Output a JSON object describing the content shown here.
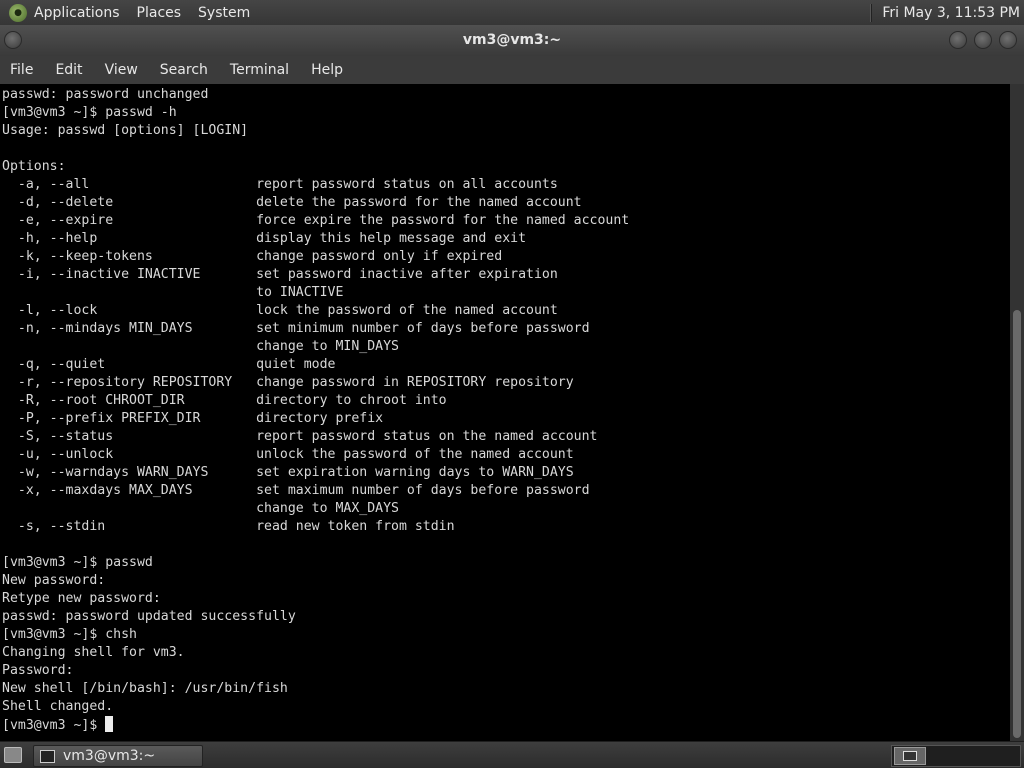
{
  "top_panel": {
    "menus": [
      "Applications",
      "Places",
      "System"
    ],
    "clock": "Fri May  3, 11:53 PM"
  },
  "window": {
    "title": "vm3@vm3:~",
    "menus": [
      "File",
      "Edit",
      "View",
      "Search",
      "Terminal",
      "Help"
    ]
  },
  "terminal": {
    "lines": [
      "passwd: password unchanged",
      "[vm3@vm3 ~]$ passwd -h",
      "Usage: passwd [options] [LOGIN]",
      "",
      "Options:",
      "  -a, --all                     report password status on all accounts",
      "  -d, --delete                  delete the password for the named account",
      "  -e, --expire                  force expire the password for the named account",
      "  -h, --help                    display this help message and exit",
      "  -k, --keep-tokens             change password only if expired",
      "  -i, --inactive INACTIVE       set password inactive after expiration",
      "                                to INACTIVE",
      "  -l, --lock                    lock the password of the named account",
      "  -n, --mindays MIN_DAYS        set minimum number of days before password",
      "                                change to MIN_DAYS",
      "  -q, --quiet                   quiet mode",
      "  -r, --repository REPOSITORY   change password in REPOSITORY repository",
      "  -R, --root CHROOT_DIR         directory to chroot into",
      "  -P, --prefix PREFIX_DIR       directory prefix",
      "  -S, --status                  report password status on the named account",
      "  -u, --unlock                  unlock the password of the named account",
      "  -w, --warndays WARN_DAYS      set expiration warning days to WARN_DAYS",
      "  -x, --maxdays MAX_DAYS        set maximum number of days before password",
      "                                change to MAX_DAYS",
      "  -s, --stdin                   read new token from stdin",
      "",
      "[vm3@vm3 ~]$ passwd",
      "New password:",
      "Retype new password:",
      "passwd: password updated successfully",
      "[vm3@vm3 ~]$ chsh",
      "Changing shell for vm3.",
      "Password:",
      "New shell [/bin/bash]: /usr/bin/fish",
      "Shell changed."
    ],
    "prompt": "[vm3@vm3 ~]$ "
  },
  "taskbar": {
    "task_label": "vm3@vm3:~"
  }
}
